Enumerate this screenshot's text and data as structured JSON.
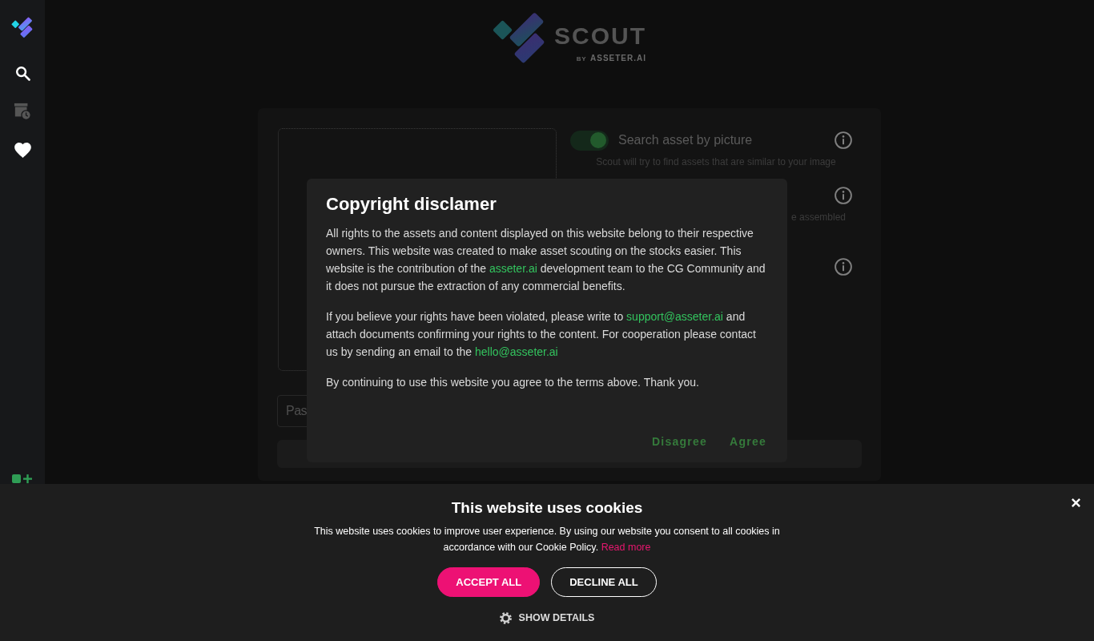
{
  "sidebar": {
    "items": [
      {
        "kind": "search",
        "disabled": false
      },
      {
        "kind": "history",
        "disabled": true
      },
      {
        "kind": "favorites",
        "disabled": false
      }
    ]
  },
  "logo": {
    "title": "SCOUT",
    "byline": "BY",
    "brand": "ASSETER.AI"
  },
  "search_panel": {
    "options": [
      {
        "kind": "toggle",
        "label": "Search asset by picture",
        "on": true,
        "hint": "Scout will try to find assets that are similar to your image"
      },
      {
        "kind": "hint_only",
        "hint": "e assembled"
      },
      {
        "kind": "icon_only"
      }
    ],
    "url_input": {
      "placeholder": "Pas"
    }
  },
  "modal": {
    "title": "Copyright disclamer",
    "paragraphs": [
      {
        "parts": [
          {
            "kind": "text",
            "text": "All rights to the assets and content displayed on this website belong to their respective owners. This website was created to make asset scouting on the stocks easier. This website is the contribution of the "
          },
          {
            "kind": "link",
            "text": "asseter.ai"
          },
          {
            "kind": "text",
            "text": " development team to the CG Community and it does not pursue the extraction of any commercial benefits."
          }
        ]
      },
      {
        "parts": [
          {
            "kind": "text",
            "text": "If you believe your rights have been violated, please write to "
          },
          {
            "kind": "link",
            "text": "support@asseter.ai"
          },
          {
            "kind": "text",
            "text": " and attach documents confirming your rights to the content. For cooperation please contact us by sending an email to the "
          },
          {
            "kind": "link",
            "text": "hello@asseter.ai"
          }
        ]
      },
      {
        "parts": [
          {
            "kind": "text",
            "text": "By continuing to use this website you agree to the terms above. Thank you."
          }
        ]
      }
    ],
    "actions": [
      {
        "label": "Disagree"
      },
      {
        "label": "Agree"
      }
    ]
  },
  "cookie_banner": {
    "title": "This website uses cookies",
    "text": "This website uses cookies to improve user experience. By using our website you consent to all cookies in accordance with our Cookie Policy.",
    "link": "Read more",
    "buttons": [
      {
        "kind": "primary",
        "label": "ACCEPT ALL"
      },
      {
        "kind": "outline",
        "label": "DECLINE ALL"
      }
    ],
    "details": "SHOW DETAILS"
  }
}
